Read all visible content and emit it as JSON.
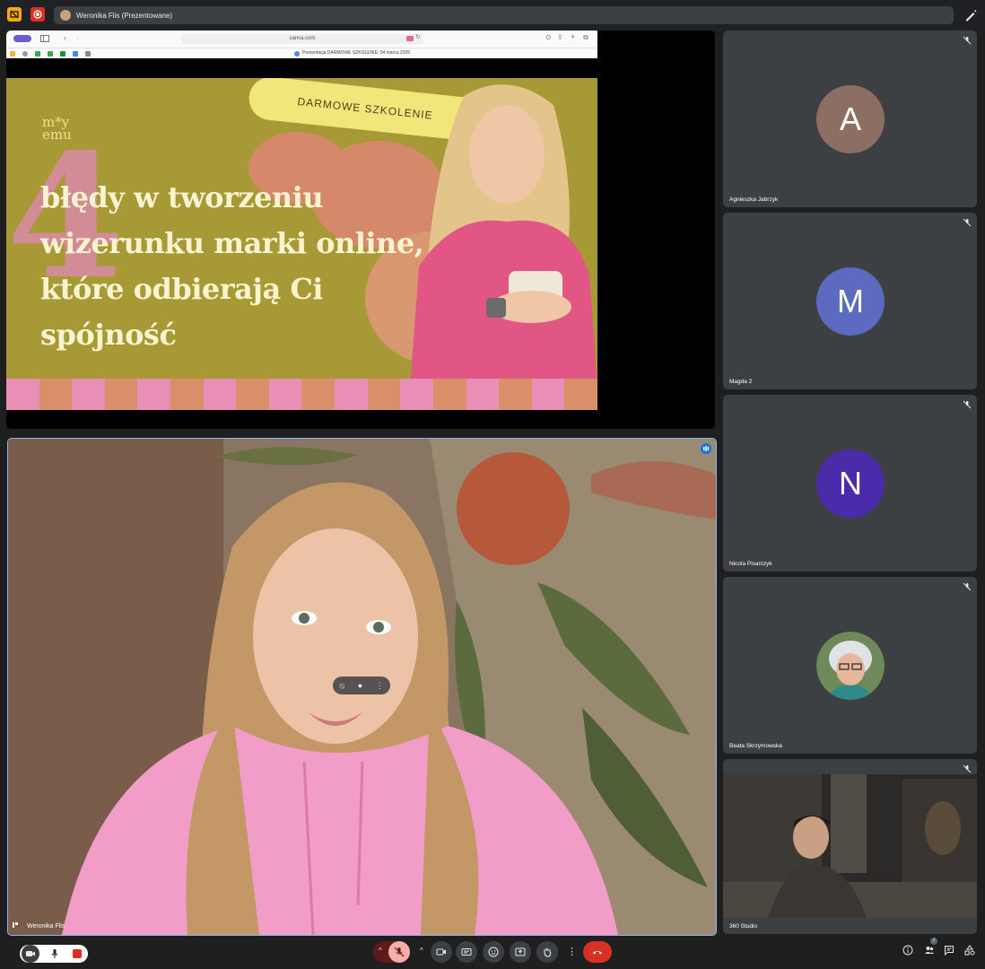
{
  "topbar": {
    "presenter_text": "Weronika Flis (Prezentowane)"
  },
  "browser": {
    "url": "canva.com",
    "tab_title": "Prezentacja DARMOWE SZKOLENIE: 04 marca 2025"
  },
  "slide": {
    "big_number": "4",
    "banner": "DARMOWE SZKOLENIE",
    "logo_line1": "m*y",
    "logo_line2": "emu",
    "headline_lines": [
      "błędy w tworzeniu",
      "wizerunku marki online,",
      "które odbierają Ci",
      "spójność"
    ]
  },
  "speaker": {
    "name": "Weronika Flis"
  },
  "participants": [
    {
      "name": "Agnieszka Jabrzyk",
      "initial": "A",
      "color": "#8d6e63"
    },
    {
      "name": "Magda 2",
      "initial": "M",
      "color": "#5c6bc0"
    },
    {
      "name": "Nicola Pisarczyk",
      "initial": "N",
      "color": "#4a2baa"
    },
    {
      "name": "Beata Skrzymowska",
      "initial": "",
      "color": "#b0c4d8"
    },
    {
      "name": "360 Studio",
      "initial": "",
      "color": "#2c2a28"
    }
  ],
  "controls": {
    "people_count": "7"
  },
  "colors": {
    "accent_blue": "#8ab4f8",
    "end_call_red": "#d93025",
    "mic_off_pink": "#f6aea9",
    "tile_bg": "#3c4043"
  }
}
